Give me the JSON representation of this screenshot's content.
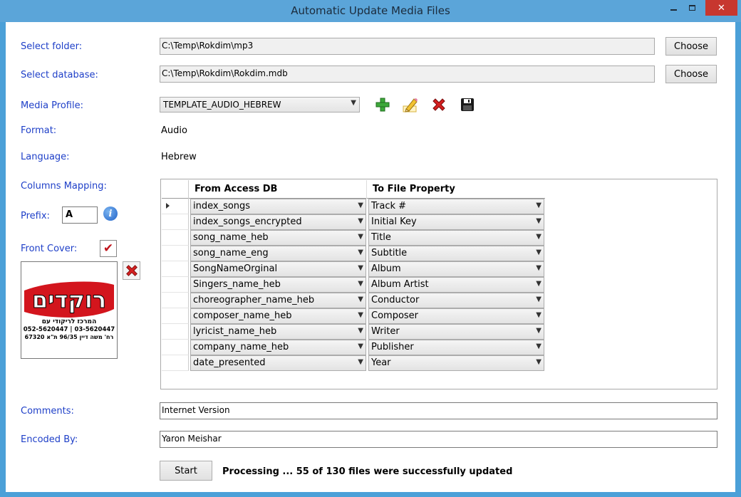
{
  "window": {
    "title": "Automatic Update Media Files"
  },
  "labels": {
    "select_folder": "Select folder:",
    "select_database": "Select database:",
    "media_profile": "Media Profile:",
    "format": "Format:",
    "language": "Language:",
    "columns_mapping": "Columns Mapping:",
    "prefix": "Prefix:",
    "front_cover": "Front Cover:",
    "comments": "Comments:",
    "encoded_by": "Encoded By:"
  },
  "fields": {
    "folder_path": "C:\\Temp\\Rokdim\\mp3",
    "database_path": "C:\\Temp\\Rokdim\\Rokdim.mdb",
    "media_profile": "TEMPLATE_AUDIO_HEBREW",
    "format_value": "Audio",
    "language_value": "Hebrew",
    "prefix_value": "A",
    "front_cover_checked": true,
    "comments_value": "Internet Version",
    "encoded_by_value": "Yaron Meishar"
  },
  "buttons": {
    "choose_folder": "Choose",
    "choose_database": "Choose",
    "start": "Start"
  },
  "icons": {
    "add": "add-profile-icon",
    "edit": "edit-profile-icon",
    "delete": "delete-profile-icon",
    "save": "save-profile-icon",
    "info": "info-icon",
    "remove_cover": "remove-cover-icon"
  },
  "cover_image": {
    "logo_text": "רוקדים",
    "tagline": "המרכז לריקודי עם",
    "phones": "052-5620447 | 03-5620447",
    "address": "רח' משה דיין 96/35 ת\"א 67320"
  },
  "grid": {
    "headers": {
      "from": "From Access DB",
      "to": "To File Property"
    },
    "rows": [
      {
        "from": "index_songs",
        "to": "Track #"
      },
      {
        "from": "index_songs_encrypted",
        "to": "Initial Key"
      },
      {
        "from": "song_name_heb",
        "to": "Title"
      },
      {
        "from": "song_name_eng",
        "to": "Subtitle"
      },
      {
        "from": "SongNameOrginal",
        "to": "Album"
      },
      {
        "from": "Singers_name_heb",
        "to": "Album Artist"
      },
      {
        "from": "choreographer_name_heb",
        "to": "Conductor"
      },
      {
        "from": "composer_name_heb",
        "to": "Composer"
      },
      {
        "from": "lyricist_name_heb",
        "to": "Writer"
      },
      {
        "from": "company_name_heb",
        "to": "Publisher"
      },
      {
        "from": "date_presented",
        "to": "Year"
      }
    ]
  },
  "status": {
    "text": "Processing ... 55 of 130 files were successfully updated"
  },
  "colors": {
    "label_blue": "#1e3fc8",
    "title_bar": "#5ba5d9",
    "close_red": "#c7372f",
    "logo_red": "#d3151d"
  }
}
